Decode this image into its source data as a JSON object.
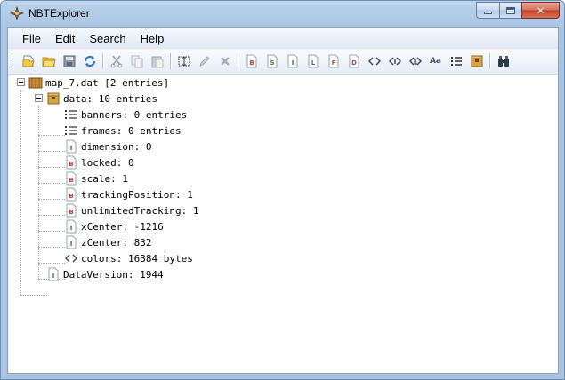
{
  "window": {
    "title": "NBTExplorer"
  },
  "menu": [
    "File",
    "Edit",
    "Search",
    "Help"
  ],
  "toolbar": {
    "type_letters": {
      "byte": "B",
      "short": "S",
      "int": "I",
      "long": "L",
      "float": "F",
      "double": "D",
      "string": "Aa"
    }
  },
  "tree": {
    "root": {
      "label": "map_7.dat [2 entries]",
      "icon": "file-icon"
    },
    "data": {
      "label": "data: 10 entries",
      "icon": "compound-icon"
    },
    "children": [
      {
        "label": "banners: 0 entries",
        "icon": "list-icon"
      },
      {
        "label": "frames: 0 entries",
        "icon": "list-icon"
      },
      {
        "label": "dimension: 0",
        "icon": "int-tag-icon"
      },
      {
        "label": "locked: 0",
        "icon": "byte-tag-icon"
      },
      {
        "label": "scale: 1",
        "icon": "byte-tag-icon"
      },
      {
        "label": "trackingPosition: 1",
        "icon": "byte-tag-icon"
      },
      {
        "label": "unlimitedTracking: 1",
        "icon": "byte-tag-icon"
      },
      {
        "label": "xCenter: -1216",
        "icon": "int-tag-icon"
      },
      {
        "label": "zCenter: 832",
        "icon": "int-tag-icon"
      },
      {
        "label": "colors: 16384 bytes",
        "icon": "byte-array-icon"
      }
    ],
    "data_version": {
      "label": "DataVersion: 1944",
      "icon": "int-tag-icon"
    }
  },
  "colors": {
    "tag_red": "#c0392b",
    "tag_blue": "#2f5fa8",
    "folder_gold": "#d9a441"
  }
}
